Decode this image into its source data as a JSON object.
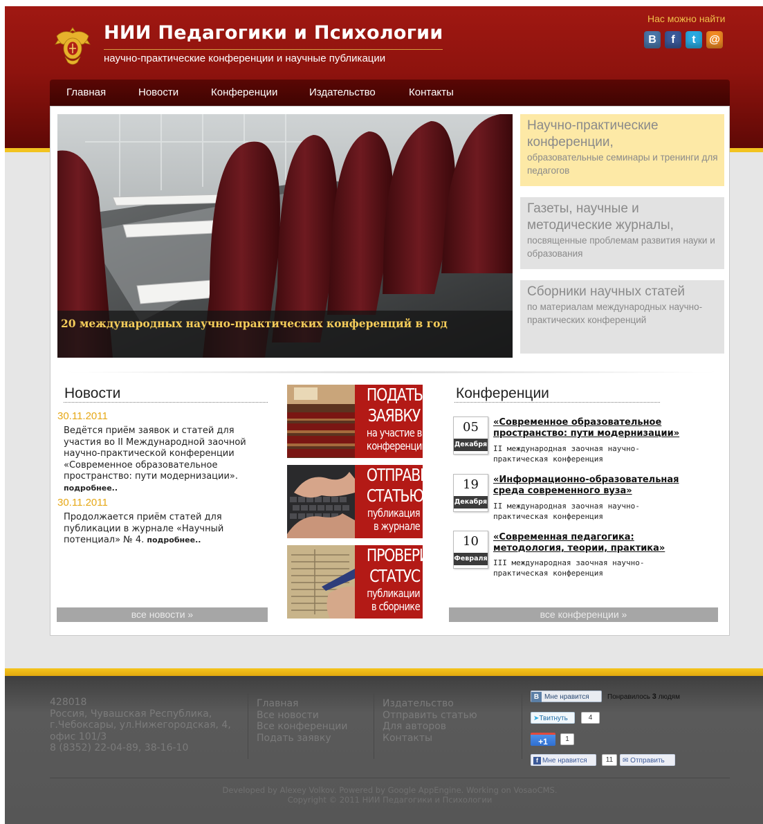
{
  "header": {
    "title": "НИИ Педагогики и Психологии",
    "subtitle": "научно-практические конференции и научные публикации",
    "find_us": "Нас можно найти",
    "social": [
      {
        "icon": "vk-icon",
        "glyph": "B",
        "color": "#4a76a8"
      },
      {
        "icon": "facebook-icon",
        "glyph": "f",
        "color": "#3b5998"
      },
      {
        "icon": "twitter-icon",
        "glyph": "t",
        "color": "#2aa9e0"
      },
      {
        "icon": "email-icon",
        "glyph": "@",
        "color": "#f08a24"
      }
    ]
  },
  "nav": [
    "Главная",
    "Новости",
    "Конференции",
    "Издательство",
    "Контакты"
  ],
  "hero": {
    "caption": "20 международных научно-практических конференций в год"
  },
  "promos": [
    {
      "title": "Научно-практические конференции,",
      "desc": "образовательные семинары и тренинги для педагогов",
      "bg": "#fde9a6"
    },
    {
      "title": "Газеты, научные и методические журналы,",
      "desc": "посвященные проблемам развития науки и образования",
      "bg": "#e2e2e2"
    },
    {
      "title": "Сборники научных статей",
      "desc": "по материалам международных научно-практических конференций",
      "bg": "#e2e2e2"
    }
  ],
  "news": {
    "title": "Новости",
    "items": [
      {
        "date": "30.11.2011",
        "text": "Ведётся приём заявок и статей для участия во II Международной заочной научно-практической конференции «Современное образовательное пространство: пути модернизации».",
        "more": "подробнее.."
      },
      {
        "date": "30.11.2011",
        "text": "Продолжается приём статей для публикации в журнале «Научный потенциал» № 4.",
        "more": "подробнее.."
      }
    ],
    "all": "все новости »"
  },
  "cta": [
    {
      "big1": "ПОДАТЬ",
      "big2": "ЗАЯВКУ",
      "small1": "на участие в",
      "small2": "конференции"
    },
    {
      "big1": "ОТПРАВИТЬ",
      "big2": "СТАТЬЮ",
      "small1": "публикация",
      "small2": "в журнале"
    },
    {
      "big1": "ПРОВЕРИТЬ",
      "big2": "СТАТУС",
      "small1": "публикации",
      "small2": "в сборнике"
    }
  ],
  "conferences": {
    "title": "Конференции",
    "items": [
      {
        "day": "05",
        "month": "Декабря",
        "title": "«Современное образовательное пространство: пути модернизации»",
        "desc": "II международная заочная научно-практическая конференция"
      },
      {
        "day": "19",
        "month": "Декабря",
        "title": "«Информационно-образовательная среда современного вуза»",
        "desc": "II международная заочная научно-практическая конференция"
      },
      {
        "day": "10",
        "month": "Февраля",
        "title": "«Современная педагогика: методология, теории, практика»",
        "desc": "III международная заочная научно-практическая конференция"
      }
    ],
    "all": "все конференции »"
  },
  "footer": {
    "address": [
      "428018",
      "Россия, Чувашская Республика,",
      "г.Чебоксары, ул.Нижегородская, 4,",
      "офис 101/3",
      "8 (8352) 22-04-89, 38-16-10"
    ],
    "links1": [
      "Главная",
      "Все новости",
      "Все конференции",
      "Подать заявку"
    ],
    "links2": [
      "Издательство",
      "Отправить статью",
      "Для авторов",
      "Контакты"
    ],
    "widgets": {
      "vk_like": "Мне нравится",
      "vk_count_text": "Понравилось",
      "vk_count_num": "3",
      "vk_count_suffix": "людям",
      "tweet": "Твитнуть",
      "tweet_count": "4",
      "gplus": "+1",
      "gplus_count": "1",
      "fb_like": "Мне нравится",
      "fb_count": "11",
      "fb_send": "Отправить"
    },
    "credits1": "Developed by Alexey Volkov. Powered by Google AppEngine. Working on VosaoCMS.",
    "credits2": "Copyright © 2011 НИИ Педагогики и Психологии"
  }
}
